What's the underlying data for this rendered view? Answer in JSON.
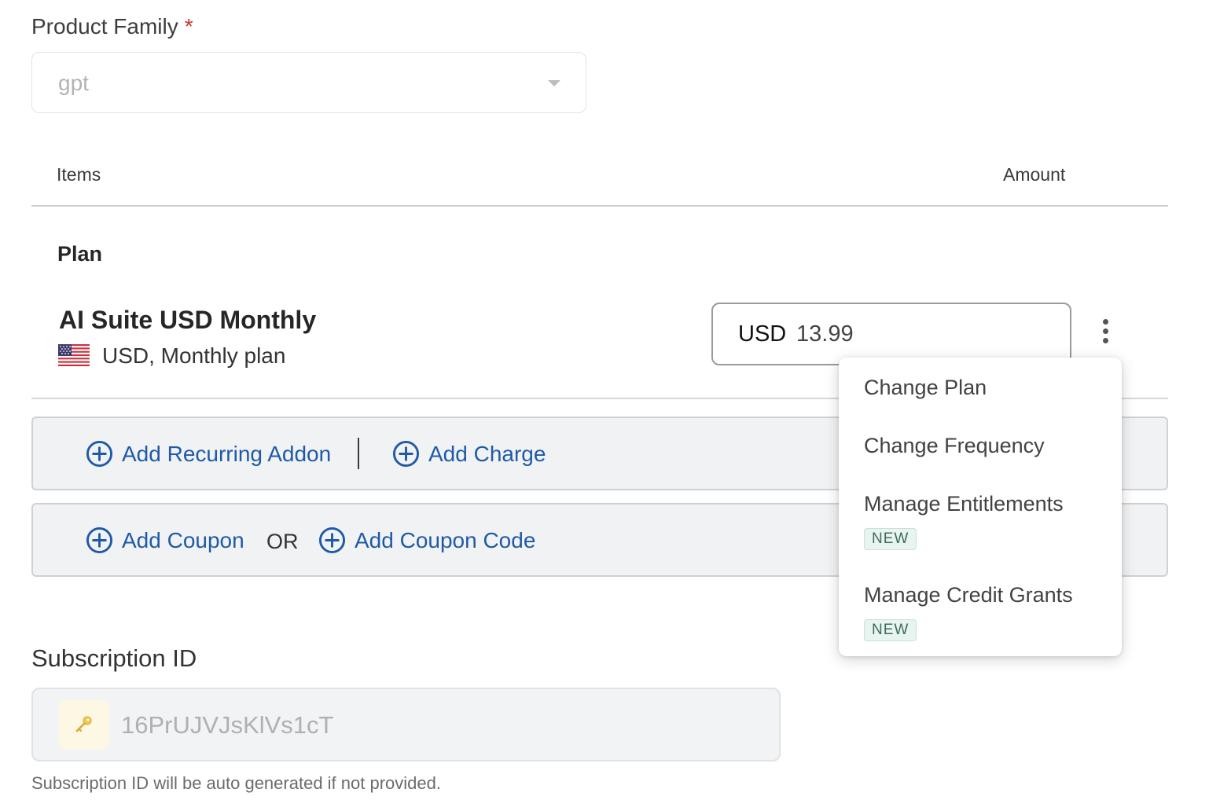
{
  "product_family": {
    "label": "Product Family",
    "required_mark": "*",
    "selected_value": "gpt"
  },
  "table": {
    "col_items": "Items",
    "col_amount": "Amount"
  },
  "plan": {
    "section_heading": "Plan",
    "name": "AI Suite USD Monthly",
    "description": "USD, Monthly plan",
    "flag_icon": "us-flag-icon",
    "currency": "USD",
    "amount": "13.99"
  },
  "addons": {
    "add_recurring_addon": "Add Recurring Addon",
    "add_charge": "Add Charge",
    "add_coupon": "Add Coupon",
    "or_text": "OR",
    "add_coupon_code": "Add Coupon Code",
    "icon": "plus-circle-icon",
    "link_color": "#1f5aa6"
  },
  "menu": {
    "items": [
      {
        "label": "Change Plan"
      },
      {
        "label": "Change Frequency"
      },
      {
        "label": "Manage Entitlements",
        "badge": "NEW"
      },
      {
        "label": "Manage Credit Grants",
        "badge": "NEW"
      }
    ]
  },
  "subscription_id": {
    "label": "Subscription ID",
    "value": "16PrUJVJsKlVs1cT",
    "icon": "key-icon",
    "help_text": "Subscription ID will be auto generated if not provided."
  }
}
